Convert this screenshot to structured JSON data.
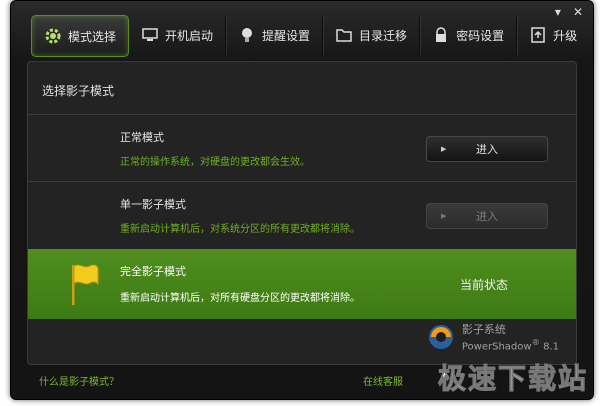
{
  "window": {
    "minimize_icon": "minimize-icon",
    "close_icon": "close-icon"
  },
  "tabs": [
    {
      "label": "模式选择",
      "icon": "gear-icon"
    },
    {
      "label": "开机启动",
      "icon": "monitor-icon"
    },
    {
      "label": "提醒设置",
      "icon": "lightbulb-icon"
    },
    {
      "label": "目录迁移",
      "icon": "folder-icon"
    },
    {
      "label": "密码设置",
      "icon": "lock-icon"
    },
    {
      "label": "升级",
      "icon": "upgrade-icon"
    }
  ],
  "panel": {
    "title": "选择影子模式"
  },
  "modes": [
    {
      "name": "正常模式",
      "desc": "正常的操作系统，对硬盘的更改都会生效。",
      "button": "进入",
      "state": "enabled"
    },
    {
      "name": "单一影子模式",
      "desc": "重新启动计算机后，对系统分区的所有更改都将消除。",
      "button": "进入",
      "state": "disabled"
    },
    {
      "name": "完全影子模式",
      "desc": "重新启动计算机后，对所有硬盘分区的更改都将消除。",
      "status": "当前状态",
      "state": "current"
    }
  ],
  "brand": {
    "name": "影子系统",
    "product": "PowerShadow",
    "version": "8.1",
    "registered": "®"
  },
  "footer": {
    "help_link": "什么是影子模式？",
    "support_link": "在线客服"
  },
  "watermark": "极速下载站",
  "colors": {
    "accent": "#4f8e1e",
    "desc_text": "#6fb01f"
  }
}
